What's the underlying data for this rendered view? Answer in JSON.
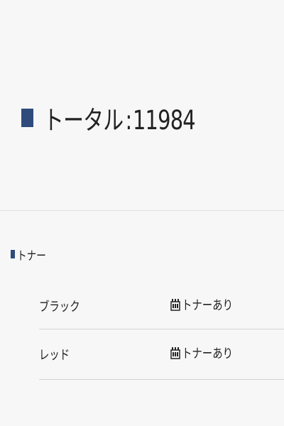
{
  "total": {
    "label": "トータル",
    "separator": ":",
    "value": "11984"
  },
  "toner": {
    "title": "トナー",
    "items": [
      {
        "color": "ブラック",
        "status": "トナーあり",
        "icon": "toner-cartridge-icon"
      },
      {
        "color": "レッド",
        "status": "トナーあり",
        "icon": "toner-cartridge-icon"
      }
    ]
  },
  "colors": {
    "accent": "#2f4b7c"
  }
}
